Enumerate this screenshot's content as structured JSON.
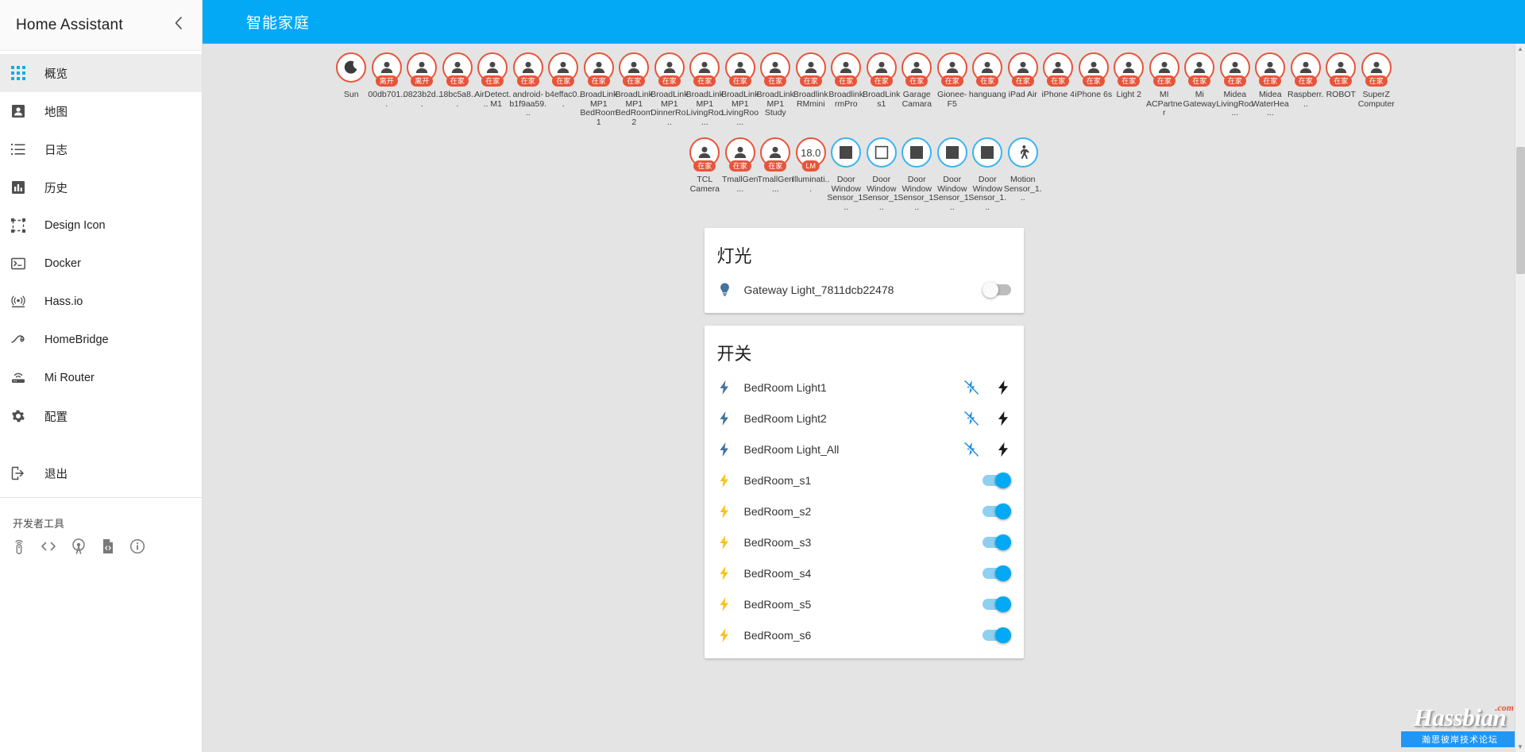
{
  "sidebar": {
    "title": "Home Assistant",
    "collapse_icon": "chevron-left-icon",
    "items": [
      {
        "label": "概览",
        "icon": "apps-grid-icon",
        "active": true
      },
      {
        "label": "地图",
        "icon": "account-badge-icon",
        "active": false
      },
      {
        "label": "日志",
        "icon": "format-list-icon",
        "active": false
      },
      {
        "label": "历史",
        "icon": "chart-box-icon",
        "active": false
      },
      {
        "label": "Design Icon",
        "icon": "vector-square-icon",
        "active": false
      },
      {
        "label": "Docker",
        "icon": "console-icon",
        "active": false
      },
      {
        "label": "Hass.io",
        "icon": "access-point-icon",
        "active": false
      },
      {
        "label": "HomeBridge",
        "icon": "bridge-icon",
        "active": false
      },
      {
        "label": "Mi Router",
        "icon": "router-wifi-icon",
        "active": false
      },
      {
        "label": "配置",
        "icon": "gear-icon",
        "active": false
      }
    ],
    "logout": {
      "label": "退出",
      "icon": "exit-to-app-icon"
    },
    "dev_tools_title": "开发者工具",
    "dev_tools_icons": [
      "remote-icon",
      "code-tags-icon",
      "broadcast-icon",
      "file-code-icon",
      "info-circle-icon"
    ]
  },
  "toolbar": {
    "title": "智能家庭"
  },
  "badges": {
    "row1": [
      {
        "label": "Sun",
        "icon": "moon-icon",
        "state": "",
        "color": "orange"
      },
      {
        "label": "00db701...",
        "icon": "person-icon",
        "state": "离开",
        "color": "orange"
      },
      {
        "label": "0823b2d...",
        "icon": "person-icon",
        "state": "离开",
        "color": "orange"
      },
      {
        "label": "18bc5a8...",
        "icon": "person-icon",
        "state": "在家",
        "color": "orange"
      },
      {
        "label": "AirDetect... M1",
        "icon": "person-icon",
        "state": "在家",
        "color": "orange"
      },
      {
        "label": "android- b1f9aa59...",
        "icon": "person-icon",
        "state": "在家",
        "color": "orange"
      },
      {
        "label": "b4effac0...",
        "icon": "person-icon",
        "state": "在家",
        "color": "orange"
      },
      {
        "label": "BroadLink MP1 BedRoom1",
        "icon": "person-icon",
        "state": "在家",
        "color": "orange"
      },
      {
        "label": "BroadLink MP1 BedRoom2",
        "icon": "person-icon",
        "state": "在家",
        "color": "orange"
      },
      {
        "label": "BroadLink MP1 DinnerRo...",
        "icon": "person-icon",
        "state": "在家",
        "color": "orange"
      },
      {
        "label": "BroadLink MP1 LivingRoo...",
        "icon": "person-icon",
        "state": "在家",
        "color": "orange"
      },
      {
        "label": "BroadLink MP1 LivingRoo...",
        "icon": "person-icon",
        "state": "在家",
        "color": "orange"
      },
      {
        "label": "BroadLink MP1 Study",
        "icon": "person-icon",
        "state": "在家",
        "color": "orange"
      },
      {
        "label": "Broadlink RMmini",
        "icon": "person-icon",
        "state": "在家",
        "color": "orange"
      },
      {
        "label": "Broadlink rmPro",
        "icon": "person-icon",
        "state": "在家",
        "color": "orange"
      },
      {
        "label": "BroadLink s1",
        "icon": "person-icon",
        "state": "在家",
        "color": "orange"
      },
      {
        "label": "Garage Camara",
        "icon": "person-icon",
        "state": "在家",
        "color": "orange"
      },
      {
        "label": "Gionee-F5",
        "icon": "person-icon",
        "state": "在家",
        "color": "orange"
      },
      {
        "label": "hanguang",
        "icon": "person-icon",
        "state": "在家",
        "color": "orange"
      },
      {
        "label": "iPad Air",
        "icon": "person-icon",
        "state": "在家",
        "color": "orange"
      },
      {
        "label": "iPhone 4",
        "icon": "person-icon",
        "state": "在家",
        "color": "orange"
      },
      {
        "label": "iPhone 6s",
        "icon": "person-icon",
        "state": "在家",
        "color": "orange"
      },
      {
        "label": "Light 2",
        "icon": "person-icon",
        "state": "在家",
        "color": "orange"
      },
      {
        "label": "MI ACPartner",
        "icon": "person-icon",
        "state": "在家",
        "color": "orange"
      },
      {
        "label": "Mi Gateway",
        "icon": "person-icon",
        "state": "在家",
        "color": "orange"
      },
      {
        "label": "Midea LivingRoo...",
        "icon": "person-icon",
        "state": "在家",
        "color": "orange"
      },
      {
        "label": "Midea WaterHea...",
        "icon": "person-icon",
        "state": "在家",
        "color": "orange"
      },
      {
        "label": "Raspberr...",
        "icon": "person-icon",
        "state": "在家",
        "color": "orange"
      },
      {
        "label": "ROBOT",
        "icon": "person-icon",
        "state": "在家",
        "color": "orange"
      },
      {
        "label": "SuperZ Computer",
        "icon": "person-icon",
        "state": "在家",
        "color": "orange"
      }
    ],
    "row2": [
      {
        "label": "TCL Camera",
        "icon": "person-icon",
        "state": "在家",
        "color": "orange"
      },
      {
        "label": "TmallGen...",
        "icon": "person-icon",
        "state": "在家",
        "color": "orange"
      },
      {
        "label": "TmallGen...",
        "icon": "person-icon",
        "state": "在家",
        "color": "orange"
      },
      {
        "label": "Illuminati...",
        "icon": "value-number",
        "value": "18.0",
        "state": "LM",
        "color": "orange"
      },
      {
        "label": "Door Window Sensor_1...",
        "icon": "square-filled-icon",
        "state": "",
        "color": "blue"
      },
      {
        "label": "Door Window Sensor_1...",
        "icon": "square-outline-icon",
        "state": "",
        "color": "blue"
      },
      {
        "label": "Door Window Sensor_1...",
        "icon": "square-filled-icon",
        "state": "",
        "color": "blue"
      },
      {
        "label": "Door Window Sensor_1...",
        "icon": "square-filled-icon",
        "state": "",
        "color": "blue"
      },
      {
        "label": "Door Window Sensor_1...",
        "icon": "square-filled-icon",
        "state": "",
        "color": "blue"
      },
      {
        "label": "Motion Sensor_1...",
        "icon": "walk-icon",
        "state": "",
        "color": "blue"
      }
    ]
  },
  "cards": [
    {
      "title": "灯光",
      "rows": [
        {
          "name": "Gateway Light_7811dcb22478",
          "icon": "lightbulb-icon",
          "control": "toggle",
          "state": "off"
        }
      ]
    },
    {
      "title": "开关",
      "rows": [
        {
          "name": "BedRoom Light1",
          "icon": "flash-blue-icon",
          "control": "flash-pair",
          "flash_off_icon": "flash-off-icon",
          "flash_on_icon": "flash-icon"
        },
        {
          "name": "BedRoom Light2",
          "icon": "flash-blue-icon",
          "control": "flash-pair",
          "flash_off_icon": "flash-off-icon",
          "flash_on_icon": "flash-icon"
        },
        {
          "name": "BedRoom Light_All",
          "icon": "flash-blue-icon",
          "control": "flash-pair",
          "flash_off_icon": "flash-off-icon",
          "flash_on_icon": "flash-icon"
        },
        {
          "name": "BedRoom_s1",
          "icon": "flash-yellow-icon",
          "control": "toggle",
          "state": "on"
        },
        {
          "name": "BedRoom_s2",
          "icon": "flash-yellow-icon",
          "control": "toggle",
          "state": "on"
        },
        {
          "name": "BedRoom_s3",
          "icon": "flash-yellow-icon",
          "control": "toggle",
          "state": "on"
        },
        {
          "name": "BedRoom_s4",
          "icon": "flash-yellow-icon",
          "control": "toggle",
          "state": "on"
        },
        {
          "name": "BedRoom_s5",
          "icon": "flash-yellow-icon",
          "control": "toggle",
          "state": "on"
        },
        {
          "name": "BedRoom_s6",
          "icon": "flash-yellow-icon",
          "control": "toggle",
          "state": "on"
        }
      ]
    }
  ],
  "watermark": {
    "main": "Hassbian",
    "com": ".com",
    "sub": "瀚思彼岸技术论坛"
  },
  "colors": {
    "accent": "#03a9f4",
    "badge_orange": "#e8543a",
    "badge_blue": "#39b4ef",
    "toggle_on": "#03a9f4"
  }
}
